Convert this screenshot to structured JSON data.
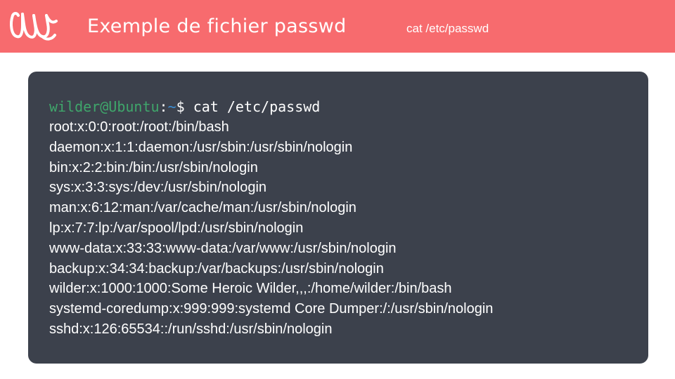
{
  "header": {
    "title": "Exemple de fichier passwd",
    "subtitle": "cat /etc/passwd",
    "logo_icon": "wild-code-school-logo-icon",
    "background_color": "#f76b6e"
  },
  "terminal": {
    "background_color": "#3c414c",
    "prompt": {
      "user_host": "wilder@Ubuntu",
      "colon": ":",
      "path": "~",
      "symbol": "$",
      "command": " cat /etc/passwd",
      "user_color": "#3fa66b",
      "path_color": "#3b8fd6"
    },
    "output_lines": [
      "root:x:0:0:root:/root:/bin/bash",
      "daemon:x:1:1:daemon:/usr/sbin:/usr/sbin/nologin",
      "bin:x:2:2:bin:/bin:/usr/sbin/nologin",
      "sys:x:3:3:sys:/dev:/usr/sbin/nologin",
      "man:x:6:12:man:/var/cache/man:/usr/sbin/nologin",
      "lp:x:7:7:lp:/var/spool/lpd:/usr/sbin/nologin",
      "www-data:x:33:33:www-data:/var/www:/usr/sbin/nologin",
      "backup:x:34:34:backup:/var/backups:/usr/sbin/nologin",
      "wilder:x:1000:1000:Some Heroic Wilder,,,:/home/wilder:/bin/bash",
      "systemd-coredump:x:999:999:systemd Core Dumper:/:/usr/sbin/nologin",
      "sshd:x:126:65534::/run/sshd:/usr/sbin/nologin"
    ]
  }
}
